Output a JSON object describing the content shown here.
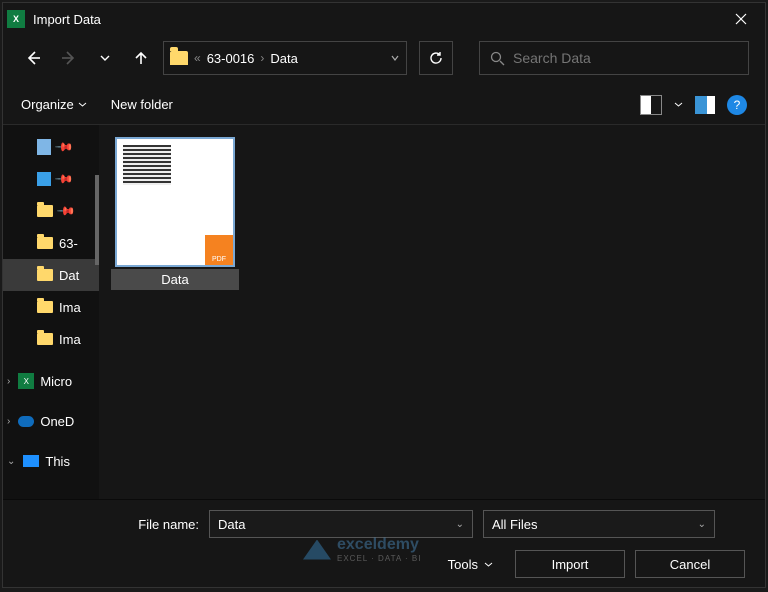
{
  "window": {
    "title": "Import Data"
  },
  "breadcrumb": {
    "prefix": "«",
    "parts": [
      "63-0016",
      "Data"
    ]
  },
  "search": {
    "placeholder": "Search Data"
  },
  "toolbar": {
    "organize": "Organize",
    "new_folder": "New folder",
    "help": "?"
  },
  "sidebar": {
    "items": [
      {
        "label": "",
        "kind": "doc",
        "pinned": true
      },
      {
        "label": "",
        "kind": "img",
        "pinned": true
      },
      {
        "label": "",
        "kind": "folder",
        "pinned": true
      },
      {
        "label": "63-",
        "kind": "folder"
      },
      {
        "label": "Dat",
        "kind": "folder",
        "selected": true
      },
      {
        "label": "Ima",
        "kind": "folder"
      },
      {
        "label": "Ima",
        "kind": "folder"
      },
      {
        "label": "Micro",
        "kind": "excel",
        "expandable": true
      },
      {
        "label": "OneD",
        "kind": "cloud",
        "expandable": true
      },
      {
        "label": "This",
        "kind": "pc",
        "expanded": true
      }
    ]
  },
  "files": [
    {
      "name": "Data",
      "badge": "PDF",
      "selected": true
    }
  ],
  "footer": {
    "filename_label": "File name:",
    "filename_value": "Data",
    "filter": "All Files",
    "tools": "Tools",
    "import": "Import",
    "cancel": "Cancel"
  },
  "watermark": {
    "brand": "exceldemy",
    "tagline": "EXCEL · DATA · BI"
  }
}
